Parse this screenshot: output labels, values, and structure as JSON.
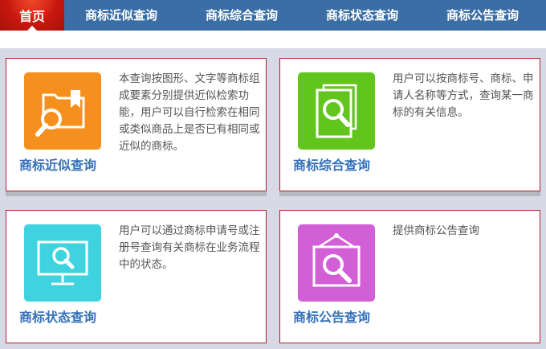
{
  "nav": {
    "home": "首页",
    "items": [
      "商标近似查询",
      "商标综合查询",
      "商标状态查询",
      "商标公告查询"
    ]
  },
  "cards": [
    {
      "title": "商标近似查询",
      "desc": "本查询按图形、文字等商标组成要素分别提供近似检索功能，用户可以自行检索在相同或类似商品上是否已有相同或近似的商标。",
      "color": "#f5901e",
      "icon": "folder-search-icon"
    },
    {
      "title": "商标综合查询",
      "desc": "用户可以按商标号、商标、申请人名称等方式，查询某一商标的有关信息。",
      "color": "#62c51c",
      "icon": "document-search-icon"
    },
    {
      "title": "商标状态查询",
      "desc": "用户可以通过商标申请号或注册号查询有关商标在业务流程中的状态。",
      "color": "#3fd3e0",
      "icon": "monitor-search-icon"
    },
    {
      "title": "商标公告查询",
      "desc": "提供商标公告查询",
      "color": "#d35fd7",
      "icon": "frame-search-icon"
    }
  ]
}
